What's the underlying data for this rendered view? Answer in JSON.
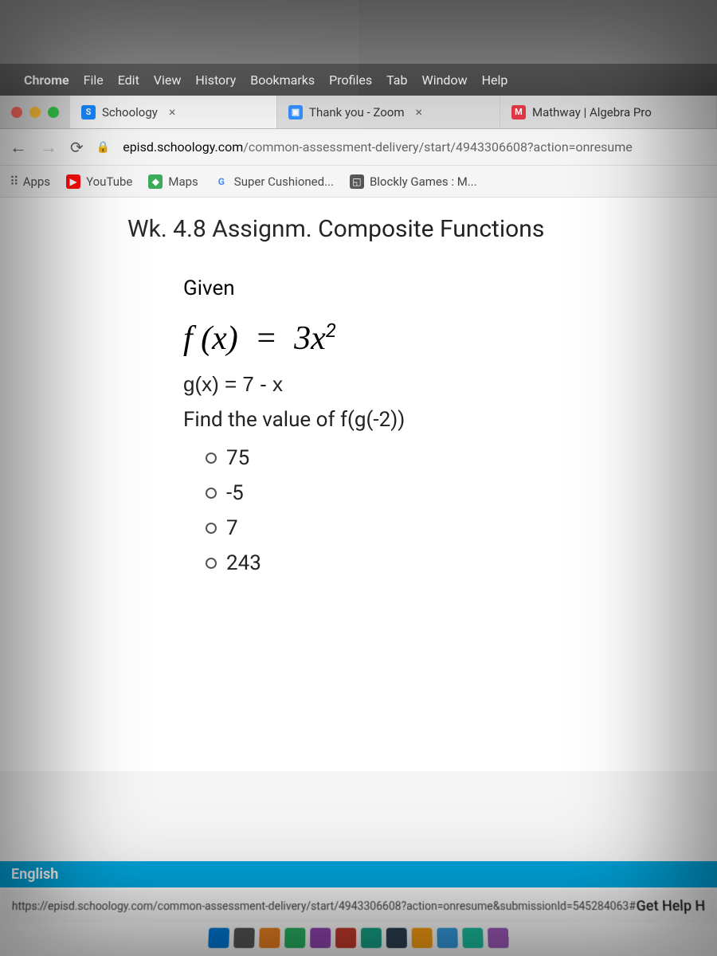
{
  "menubar": {
    "app": "Chrome",
    "items": [
      "File",
      "Edit",
      "View",
      "History",
      "Bookmarks",
      "Profiles",
      "Tab",
      "Window",
      "Help"
    ]
  },
  "tabs": {
    "t1": "Schoology",
    "t2": "Thank you - Zoom",
    "t3": "Mathway | Algebra Pro"
  },
  "url": {
    "domain": "episd.schoology.com",
    "path": "/common-assessment-delivery/start/4943306608?action=onresume"
  },
  "bookmarks": {
    "apps": "Apps",
    "b1": "YouTube",
    "b2": "Maps",
    "b3": "Super Cushioned...",
    "b4": "Blockly Games : M..."
  },
  "page": {
    "title": "Wk. 4.8 Assignm. Composite Functions",
    "given": "Given",
    "gx": "g(x) = 7 - x",
    "find": "Find the value of f(g(-2))",
    "opts": {
      "a": "75",
      "b": "-5",
      "c": "7",
      "d": "243"
    }
  },
  "footer": {
    "lang": "English",
    "statusurl": "https://episd.schoology.com/common-assessment-delivery/start/4943306608?action=onresume&submissionId=545284063#",
    "help": "Get Help H"
  }
}
